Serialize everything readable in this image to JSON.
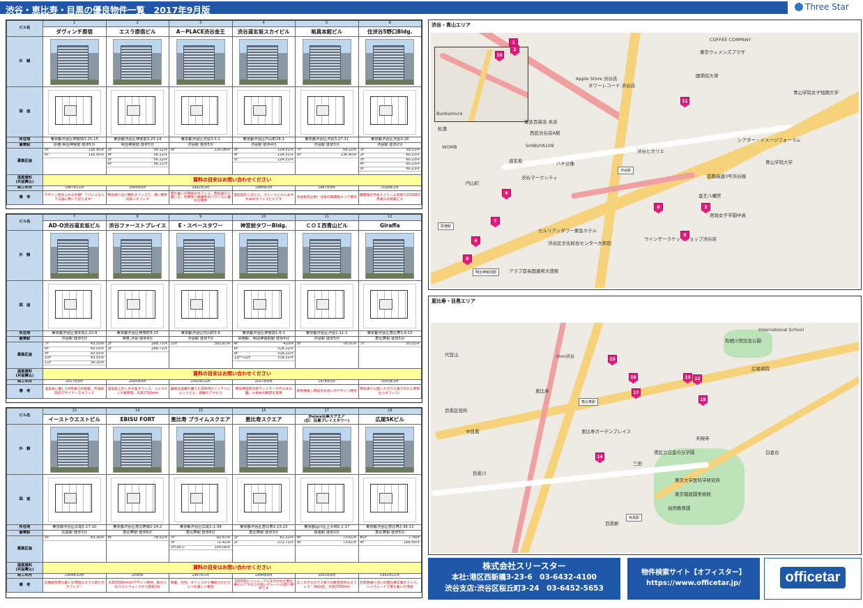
{
  "title": "渋谷・恵比寿・目黒の優良物件一覧　2017年9月版",
  "brand": "Three Star",
  "labels": {
    "name": "ビル名",
    "photo": "外　観",
    "plan": "図　面",
    "address": "所在地",
    "access": "最寄駅",
    "floors": "募集区画",
    "docs": "提案資料",
    "docs2": "(共益費込)",
    "built": "竣工年月",
    "remarks": "備　考"
  },
  "inquiry": "賃料の目安はお問い合わせください",
  "sections": [
    {
      "buildings": [
        {
          "num": "1",
          "name": "ダヴィンチ原宿",
          "address": "東京都渋谷区神宮前3-25-15",
          "access": "原宿,明治神宮前 徒歩5分",
          "floors": [
            {
              "f": "5F",
              "a": "116.95坪"
            },
            {
              "f": "6F",
              "a": "116.95坪"
            }
          ],
          "built": "1987年12月",
          "remarks": "デザイン性あふれる外観！アパレル分１ＴＯ設に例いております！"
        },
        {
          "num": "2",
          "name": "エスラ原宿ビル",
          "address": "東京都渋谷区神宮前3-25-14",
          "access": "明治神宮前 徒歩5分",
          "floors": [
            {
              "f": "3F",
              "a": "56.12坪"
            },
            {
              "f": "4F",
              "a": "56.12坪"
            },
            {
              "f": "5F",
              "a": "56.12坪"
            },
            {
              "f": "6F",
              "a": "56.12坪"
            }
          ],
          "built": "1993年9月",
          "remarks": "明治通り沿い整形オフィスで、使い勝手の良いオフィス"
        },
        {
          "num": "3",
          "name": "A－PLACE渋谷金王",
          "address": "東京都渋谷区渋谷3-3-1",
          "access": "渋谷駅 徒歩5分",
          "floors": [
            {
              "f": "6F",
              "a": "135.06坪"
            }
          ],
          "built": "1992年3月",
          "remarks": "落ち着いた環境のオフィス。明治通りに面した、利便性と静粛性のバランスに優れた物件"
        },
        {
          "num": "4",
          "name": "渋谷道玄坂スカイビル",
          "address": "東京都渋谷区円山町28-1",
          "access": "渋谷駅 徒歩4分",
          "floors": [
            {
              "f": "3F",
              "a": "124.51坪"
            },
            {
              "f": "4F",
              "a": "124.51坪"
            },
            {
              "f": "5F",
              "a": "124.51坪"
            }
          ],
          "built": "1988年3月",
          "remarks": "道玄坂近くのビル。グレードともにおすすめのオフィスビルです"
        },
        {
          "num": "5",
          "name": "裕真本館ビル",
          "address": "東京都渋谷区渋谷3-27-11",
          "access": "渋谷駅 徒歩3分",
          "floors": [
            {
              "f": "7F",
              "a": "59.22坪"
            },
            {
              "f": "8F",
              "a": "136.40坪"
            }
          ],
          "built": "1987年9月",
          "remarks": "渋谷駅前立地！注目の再開発エリア要点"
        },
        {
          "num": "6",
          "name": "住渋谷5野口Bldg.",
          "address": "東京都渋谷区渋谷3-28",
          "access": "渋谷駅 徒歩2分",
          "floors": [
            {
              "f": "1F",
              "a": "39.31坪"
            },
            {
              "f": "2F",
              "a": "60.23坪"
            },
            {
              "f": "3F",
              "a": "60.23坪"
            },
            {
              "f": "4F",
              "a": "60.23坪"
            },
            {
              "f": "5F",
              "a": "60.23坪"
            }
          ],
          "built": "2018年2月",
          "remarks": "再開発の渋谷ストリーム近接で2018年2月竣工の新築ビル"
        }
      ]
    },
    {
      "buildings": [
        {
          "num": "7",
          "name": "AD-O渋谷道玄坂ビル",
          "address": "東京都渋谷区道玄坂1-22-9",
          "access": "渋谷駅 徒歩3分",
          "floors": [
            {
              "f": "7F",
              "a": "43.55坪"
            },
            {
              "f": "8F",
              "a": "43.55坪"
            },
            {
              "f": "9F",
              "a": "43.55坪"
            },
            {
              "f": "10F",
              "a": "43.55坪"
            },
            {
              "f": "11F",
              "a": "39.26坪"
            }
          ],
          "built": "2017年9月",
          "remarks": "道玄坂に面した9月竣工の新築、渋谷駅前のデザイナーズオフィス"
        },
        {
          "num": "8",
          "name": "渋谷ファーストプレイス",
          "address": "東京都渋谷区神泉町8-15",
          "access": "神泉,渋谷 徒歩4分",
          "floors": [
            {
              "f": "2F",
              "a": "268.71坪"
            },
            {
              "f": "3F",
              "a": "268.71坪"
            }
          ],
          "built": "2005年9月",
          "remarks": "道玄坂上近くの大型オフィス。ハイスペック基準階、天高2700mm"
        },
        {
          "num": "9",
          "name": "E・スペースタワー",
          "address": "東京都渋谷区円山町3-6",
          "access": "渋谷駅 徒歩7分",
          "floors": [
            {
              "f": "10F",
              "a": "302.67坪"
            }
          ],
          "built": "2002年11月",
          "remarks": "最新の設備を備えた300坪のインテリジェントビル、抜群のアクセス"
        },
        {
          "num": "10",
          "name": "神宮前タワーBldg.",
          "address": "東京都渋谷区神宮前1-6-1",
          "access": "原宿駅、明治神宮前駅 徒歩4分",
          "floors": [
            {
              "f": "4F",
              "a": "410坪"
            },
            {
              "f": "8F",
              "a": "318.22坪"
            },
            {
              "f": "9F",
              "a": "318.22坪"
            },
            {
              "f": "11F～22F",
              "a": "318.22坪"
            }
          ],
          "built": "2017年8月",
          "remarks": "明治神宮前の新ランドマーク代々木公園、六本木の眺望を実現"
        },
        {
          "num": "11",
          "name": "ＣＯＩ西青山ビル",
          "address": "東京都渋谷区渋谷1-11-1",
          "access": "渋谷駅 徒歩5分",
          "floors": [
            {
              "f": "6F",
              "a": "78.01坪"
            }
          ],
          "built": "1978年5月",
          "remarks": "新青梅接し環境文化会いのデザイン物件"
        },
        {
          "num": "12",
          "name": "Giraffa",
          "address": "東京都渋谷区恵比寿1-6-10",
          "access": "恵比寿駅 徒歩5分",
          "floors": [
            {
              "f": "7F",
              "a": "55.02坪"
            }
          ],
          "built": "2003年3月",
          "remarks": "明治通りに面したガラス張りのひと際目立つオフィス！"
        }
      ]
    },
    {
      "buildings": [
        {
          "num": "13",
          "name": "イーストウエストビル",
          "address": "東京都渋谷区広尾5-17-10",
          "access": "広尾駅 徒歩3分",
          "floors": [
            {
              "f": "5F",
              "a": "43.30坪"
            }
          ],
          "built": "1994年10月",
          "remarks": "広尾駅前落ち着いた環境なガラス張りのオフィス！"
        },
        {
          "num": "14",
          "name": "EBISU FORT",
          "address": "東京都渋谷区恵比寿南1-24-2",
          "access": "恵比寿駅 徒歩6分",
          "floors": [
            {
              "f": "4F",
              "a": "78.52坪"
            }
          ],
          "built": "2006年",
          "remarks": "天高3500mmのデザイン物件。駅からのスカイウォークから直歩3分"
        },
        {
          "num": "15",
          "name": "恵比寿 プライムスクエア",
          "address": "東京都渋谷区広尾1-1-39",
          "access": "恵比寿駅 徒歩8分",
          "floors": [
            {
              "f": "5F",
              "a": "82.67坪"
            },
            {
              "f": "5F",
              "a": "71.41坪"
            },
            {
              "f": "5F(SET)",
              "a": "154.08坪"
            }
          ],
          "built": "1997年1月",
          "remarks": "商業、住宅、オフィスから構成されたひとつの美しい複合"
        },
        {
          "num": "16",
          "name": "恵比寿スクエア",
          "address": "東京都渋谷区恵比寿1-23-23",
          "access": "恵比寿駅 徒歩3分",
          "floors": [
            {
              "f": "1F",
              "a": "61.31坪"
            },
            {
              "f": "2F",
              "a": "271.71坪"
            }
          ],
          "built": "1994年8月",
          "remarks": "2002年にリニューアルを行われた恵比寿からアクセスが良いグレードの高い物件です"
        },
        {
          "num": "17",
          "name": "Daiwa目黒スクエア",
          "sub": "(旧：目黒プレイスタワー)",
          "address": "東京都品川区上大崎2-1-17",
          "access": "目黒駅 徒歩2分",
          "floors": [
            {
              "f": "6F",
              "a": "73.61坪"
            },
            {
              "f": "9F",
              "a": "73.61坪"
            }
          ],
          "built": "2002年9月",
          "remarks": "広く大きなガラス張りの眺望良好なオフィス！OA対応、天高2700mm"
        },
        {
          "num": "18",
          "name": "広尾SKビル",
          "address": "東京都渋谷区恵比寿2-36-13",
          "access": "恵比寿駅 徒歩5分",
          "floors": [
            {
              "f": "B1F",
              "a": "7.76坪"
            },
            {
              "f": "4F",
              "a": "166.65坪"
            }
          ],
          "built": "1992年11月",
          "remarks": "外苑西通り沿いの恵比寿広尾オフィス。ハイグレードで落ち着いた環境"
        }
      ]
    }
  ],
  "map1": {
    "title": "渋谷・青山エリア",
    "station": "渋谷駅",
    "station2": "原宿駅",
    "station3": "明治神宮前駅",
    "labels": [
      "COFFEE COMPANY",
      "東京ウィメンズプラザ",
      "Apple Store 渋谷店",
      "タワーレコード 渋谷店",
      "國學院大學",
      "青山学院女子短期大学",
      "Bunkamura",
      "東急百貨店 本店",
      "西武渋谷店A館",
      "SHIBUYA109",
      "ハチ公像",
      "渋谷ヒカリエ",
      "渋谷マークシティ",
      "首都高速3号渋谷線",
      "金王八幡宮",
      "実践女子学園中高",
      "セルリアンタワー東急ホテル",
      "ウインザーラケットショップ渋谷店",
      "渋谷区文化総合センター大和田",
      "アラブ首長国連邦大使館",
      "青山学院大学",
      "シアター・イメージフォーラム",
      "円山町",
      "松濤",
      "道玄坂",
      "WOMB"
    ],
    "pins": [
      "1",
      "2",
      "3",
      "4",
      "5",
      "6",
      "7",
      "8",
      "9",
      "10",
      "11"
    ]
  },
  "map2": {
    "title": "恵比寿・目黒エリア",
    "station": "恵比寿駅",
    "station2": "目黒駅",
    "labels": [
      "東京都庭園美術館",
      "有栖川宮記念公園",
      "恵比寿ガーデンプレイス",
      "目黒区役所",
      "目黒川",
      "広尾病院",
      "International School",
      "天現寺",
      "目黒駅",
      "白金台",
      "東京大学医科学研究所",
      "自然教育園",
      "港区立白金の丘学園",
      "代官山",
      "中目黒",
      "三田",
      "Doo渋谷",
      "恵比寿"
    ],
    "pins": [
      "13",
      "14",
      "15",
      "16",
      "17",
      "18",
      "12"
    ]
  },
  "footer": {
    "company": "株式会社スリースター",
    "addr1": "本社:港区西新橋3-23-6　03-6432-4100",
    "addr2": "渋谷支店:渋谷区桜丘町3-24　03-6452-5653",
    "site": "物件検索サイト【オフィスター】",
    "url": "https://www.officetar.jp/",
    "logo": "officetar"
  }
}
